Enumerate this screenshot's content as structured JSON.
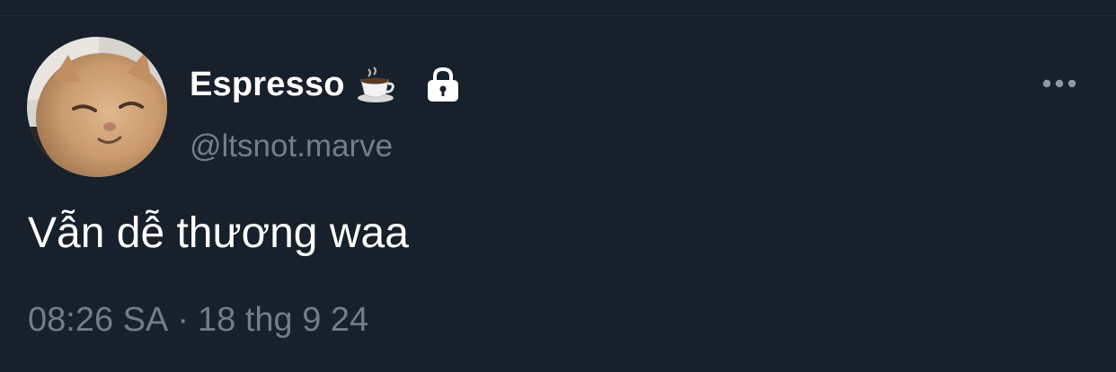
{
  "tweet": {
    "author": {
      "display_name": "Espresso",
      "name_emoji": "coffee-cup-icon",
      "protected_icon": "lock-icon",
      "handle": "@ltsnot.marve",
      "avatar": "cat-avatar"
    },
    "text": "Vẫn dễ thương waa",
    "time": "08:26 SA",
    "separator": "·",
    "date": "18 thg 9 24",
    "more_icon": "more-dots-icon"
  },
  "colors": {
    "background": "#17202b",
    "primary_text": "#ffffff",
    "secondary_text": "#6f7e8c"
  }
}
